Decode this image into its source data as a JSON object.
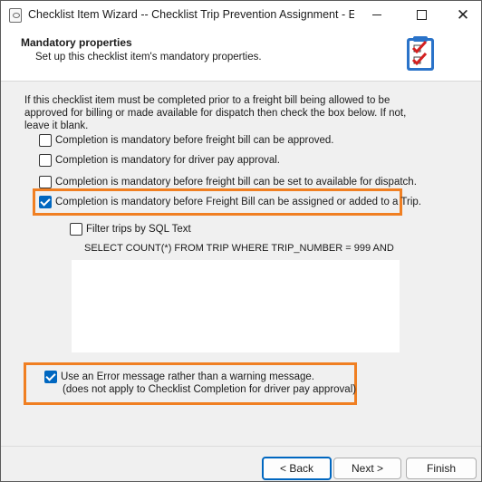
{
  "window": {
    "title": "Checklist Item Wizard -- Checklist Trip Prevention Assignment - Err..."
  },
  "header": {
    "title": "Mandatory properties",
    "subtitle": "Set up this checklist item's mandatory properties."
  },
  "content": {
    "intro": "If this checklist item must be completed prior to a freight bill being allowed to be approved for billing or made available for dispatch then check the box below. If not, leave it blank.",
    "checkboxes": [
      {
        "label": "Completion is mandatory before freight bill can be approved.",
        "checked": false
      },
      {
        "label": "Completion is mandatory for driver pay approval.",
        "checked": false
      },
      {
        "label": "Completion is mandatory before freight bill can be set to available for dispatch.",
        "checked": false
      },
      {
        "label": "Completion is mandatory before Freight Bill can be assigned or added to a Trip.",
        "checked": true
      }
    ],
    "filter_sql": {
      "label": "Filter trips by SQL Text",
      "checked": false
    },
    "sql_text": "SELECT COUNT(*) FROM TRIP WHERE TRIP_NUMBER = 999 AND",
    "error_option": {
      "label": "Use an Error message rather than a warning message.",
      "note": "(does not apply to Checklist Completion for driver pay approval)",
      "checked": true
    }
  },
  "footer": {
    "back": "< Back",
    "next": "Next >",
    "finish": "Finish"
  },
  "colors": {
    "highlight": "#f07f22",
    "accent": "#0067c0"
  }
}
